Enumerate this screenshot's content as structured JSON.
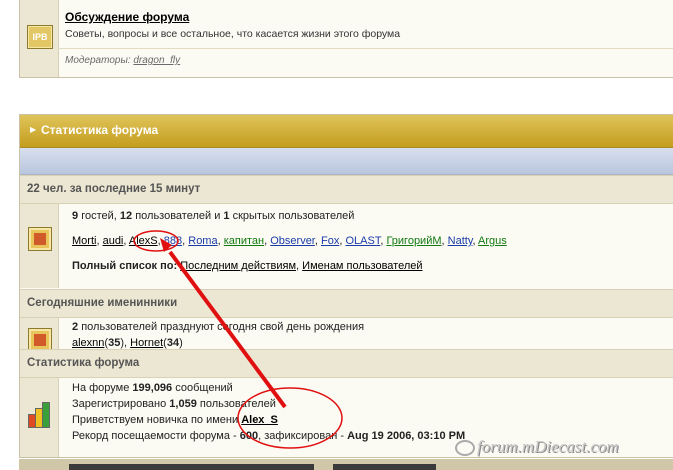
{
  "forum": {
    "icon_label": "IPB",
    "title": "Обсуждение форума",
    "description": "Советы, вопросы и все остальное, что касается жизни этого форума",
    "moderators_label": "Модераторы:",
    "moderator": "dragon_fly"
  },
  "stats": {
    "header_title": "Статистика форума",
    "online": {
      "heading": "22 чел. за последние 15 минут",
      "guests": "9",
      "guests_label": "гостей,",
      "users": "12",
      "users_label": "пользователей и",
      "hidden": "1",
      "hidden_label": "скрытых пользователей",
      "names": [
        "Morti",
        "audi",
        "AlexS",
        "888",
        "Roma",
        "капитан",
        "Observer",
        "Fox",
        "OLAST",
        "ГригорийМ",
        "Natty",
        "Argus"
      ],
      "full_list_label": "Полный список по:",
      "sort_recent": "Последним действиям",
      "sort_names": "Именам пользователей"
    },
    "birthdays": {
      "heading": "Сегодняшние именинники",
      "count": "2",
      "text": "пользователей празднуют сегодня свой день рождения",
      "users": [
        {
          "name": "alexnn",
          "age": "35"
        },
        {
          "name": "Hornet",
          "age": "34"
        }
      ]
    },
    "board": {
      "heading": "Статистика форума",
      "posts_prefix": "На форуме",
      "posts": "199,096",
      "posts_suffix": "сообщений",
      "registered_prefix": "Зарегистрировано",
      "registered": "1,059",
      "registered_suffix": "пользователей",
      "newest_prefix": "Приветствуем новичка по имени",
      "newest": "Alex_S",
      "record_prefix": "Рекорд посещаемости форума -",
      "record": "600",
      "record_mid": ", зафиксирован -",
      "record_date": "Aug 19 2006, 03:10 PM"
    }
  },
  "watermark": "forum.mDiecast.com",
  "colors": {
    "header_gold": "#c9a42a",
    "blue_bar": "#c3cde2",
    "section_bg": "#ece7d2",
    "annotation_red": "#e01010",
    "green_link": "#107a10",
    "blue_link": "#1a3ca8"
  }
}
